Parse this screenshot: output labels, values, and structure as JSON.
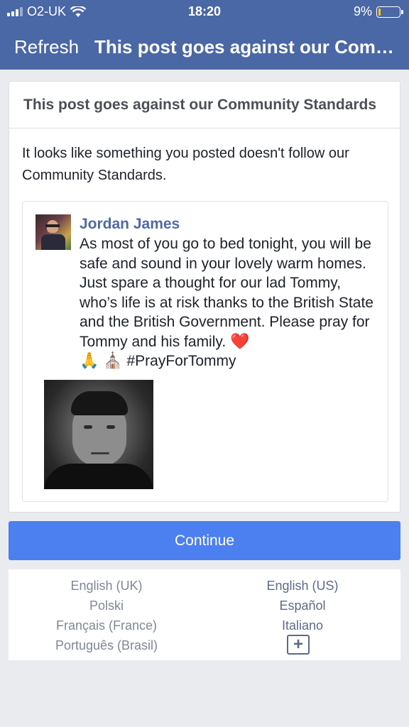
{
  "status_bar": {
    "carrier": "O2-UK",
    "time": "18:20",
    "battery_percent": "9%",
    "battery_level": 0.09,
    "signal_icon": "signal-icon",
    "wifi_icon": "wifi-icon"
  },
  "nav": {
    "refresh_label": "Refresh",
    "title": "This post goes against our Comm..."
  },
  "card": {
    "header": "This post goes against our Community Standards",
    "notice": "It looks like something you posted doesn't follow our Community Standards."
  },
  "post": {
    "author": "Jordan James",
    "text": "As most of you go to bed tonight, you will be safe and sound in your lovely warm homes. Just spare a thought for our lad Tommy, who’s life is at risk thanks to the British State and the British Government. Please pray for Tommy and his family.",
    "emoji_heart": "❤️",
    "emoji_pray": "🙏",
    "emoji_church": "⛪",
    "hashtag": "#PrayForTommy"
  },
  "continue_label": "Continue",
  "languages": {
    "left": [
      "English (UK)",
      "Polski",
      "Français (France)",
      "Português (Brasil)"
    ],
    "right": [
      "English (US)",
      "Español",
      "Italiano"
    ],
    "more_label": "+"
  },
  "colors": {
    "nav_bg": "#4a67a6",
    "button_bg": "#4c7ff0",
    "author_color": "#4f6aa3",
    "battery_color": "#ffcc00"
  }
}
